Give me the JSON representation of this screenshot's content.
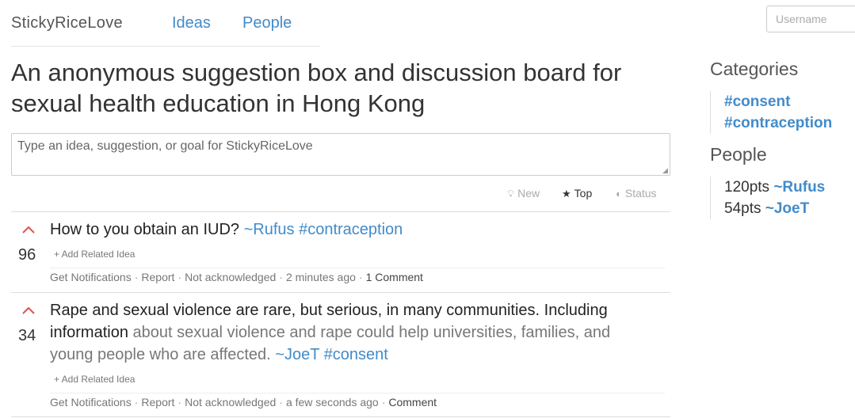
{
  "nav": {
    "brand": "StickyRiceLove",
    "ideas": "Ideas",
    "people": "People"
  },
  "login": {
    "username_placeholder": "Username"
  },
  "headline": "An anonymous suggestion box and discussion board for sexual health education in Hong Kong",
  "idea_input": {
    "placeholder": "Type an idea, suggestion, or goal for StickyRiceLove",
    "value": ""
  },
  "sort_tabs": {
    "new": "New",
    "top": "Top",
    "status": "Status",
    "active": "Top"
  },
  "ideas": [
    {
      "score": "96",
      "title": "How to you obtain an IUD?",
      "title_rest": "",
      "author": "~Rufus",
      "tag": "#contraception",
      "add_related": "+ Add Related Idea",
      "meta": {
        "notify": "Get Notifications",
        "report": "Report",
        "status": "Not acknowledged",
        "time": "2 minutes ago",
        "comments": "1 Comment"
      }
    },
    {
      "score": "34",
      "title": "Rape and sexual violence are rare, but serious, in many communities. Including information",
      "title_rest": " about sexual violence and rape could help universities, families, and young people who are affected.",
      "author": "~JoeT",
      "tag": "#consent",
      "add_related": "+ Add Related Idea",
      "meta": {
        "notify": "Get Notifications",
        "report": "Report",
        "status": "Not acknowledged",
        "time": "a few seconds ago",
        "comments": "Comment"
      }
    }
  ],
  "sidebar": {
    "categories_heading": "Categories",
    "categories": [
      "#consent",
      "#contraception"
    ],
    "people_heading": "People",
    "people": [
      {
        "points": "120pts",
        "name": "~Rufus"
      },
      {
        "points": "54pts",
        "name": "~JoeT"
      }
    ]
  },
  "colors": {
    "link": "#428bca",
    "upvote": "#d9534f",
    "muted_text": "#777777"
  },
  "icons": {
    "new": "lightbulb-icon",
    "top": "star-icon",
    "status": "half-circle-icon",
    "vote": "chevron-up-icon"
  }
}
